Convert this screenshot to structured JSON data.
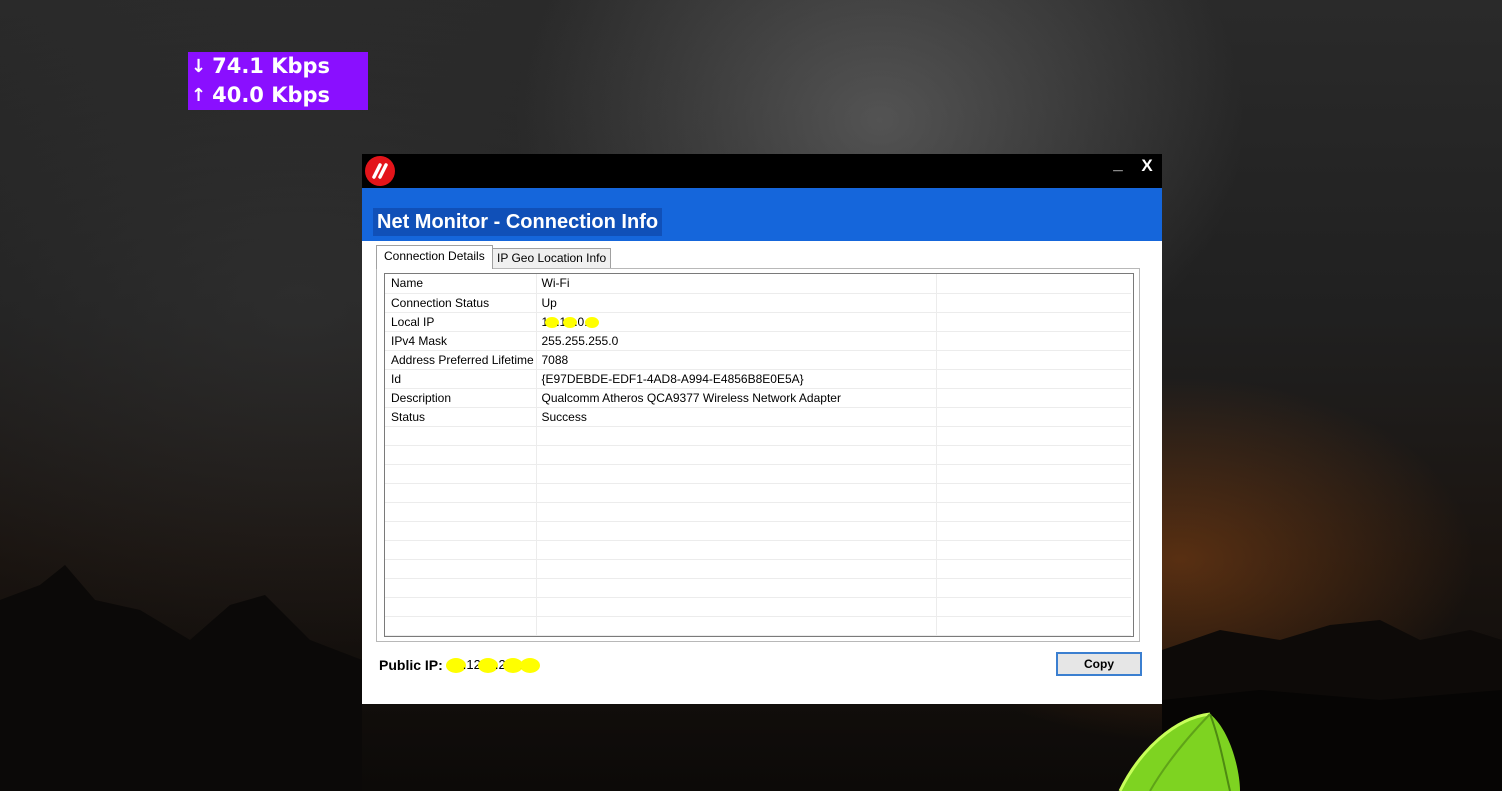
{
  "speed_widget": {
    "download": "74.1 Kbps",
    "upload": "40.0 Kbps",
    "download_icon": "arrow-down-icon",
    "upload_icon": "arrow-up-icon",
    "color": "#8a0fff"
  },
  "window": {
    "title": "Net Monitor - Connection Info",
    "app_icon": "net-monitor-logo",
    "minimize_label": "_",
    "close_label": "X",
    "header_color": "#1566db",
    "tabs": [
      {
        "label": "Connection Details",
        "active": true
      },
      {
        "label": "IP Geo Location Info",
        "active": false
      }
    ],
    "rows": [
      {
        "name": "Name",
        "value": "Wi-Fi"
      },
      {
        "name": "Connection Status",
        "value": "Up"
      },
      {
        "name": "Local IP",
        "value": "1__.1__.0.___",
        "redacted": true
      },
      {
        "name": "IPv4 Mask",
        "value": "255.255.255.0"
      },
      {
        "name": "Address Preferred Lifetime",
        "value": "7088"
      },
      {
        "name": "Id",
        "value": "{E97DEBDE-EDF1-4AD8-A994-E4856B8E0E5A}"
      },
      {
        "name": "Description",
        "value": "Qualcomm Atheros QCA9377 Wireless Network Adapter"
      },
      {
        "name": "Status",
        "value": "Success"
      }
    ],
    "public_ip_label": "Public IP:",
    "public_ip_value": "1__.12_.2__.__",
    "copy_label": "Copy"
  }
}
